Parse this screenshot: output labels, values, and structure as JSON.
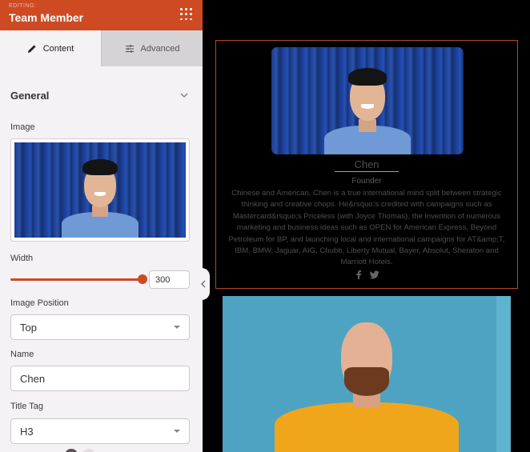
{
  "editor": {
    "editing_label": "EDITING:",
    "module_title": "Team Member",
    "menu_icon": "grid-dots-icon",
    "tabs": [
      {
        "label": "Content",
        "icon": "pencil-icon",
        "active": true
      },
      {
        "label": "Advanced",
        "icon": "sliders-icon",
        "active": false
      }
    ],
    "section": {
      "label": "General",
      "icon": "chevron-down-icon"
    },
    "fields": {
      "image": {
        "label": "Image",
        "alt": "Smiling man in light blue shirt against a blue corrugated wall"
      },
      "width": {
        "label": "Width",
        "value": "300",
        "slider_fraction": 1.0
      },
      "image_position": {
        "label": "Image Position",
        "value": "Top"
      },
      "name": {
        "label": "Name",
        "value": "Chen"
      },
      "title_tag": {
        "label": "Title Tag",
        "value": "H3"
      }
    },
    "collapse_icon": "chevron-left-icon"
  },
  "preview": {
    "card": {
      "name": "Chen",
      "role": "Founder",
      "bio": "Chinese and American, Chen is a true international mind split between strategic thinking and creative chops. He&rsquo;s credited with campaigns such as Mastercard&rsquo;s Priceless (with Joyce Thomas), the invention of numerous marketing and business ideas such as OPEN for American Express, Beyond Petroleum for BP, and launching local and international campaigns for AT&amp;T, IBM, BMW, Jaguar, AIG, Chubb, Liberty Mutual, Bayer, Absolut, Sheraton and Marriott Hotels.",
      "social": [
        {
          "name": "facebook",
          "icon": "facebook-icon"
        },
        {
          "name": "twitter",
          "icon": "twitter-icon"
        }
      ]
    },
    "second_member_image_alt": "Bald bearded man with glasses in yellow sweater against a light blue background"
  },
  "colors": {
    "accent": "#cd4a22",
    "sidebar_bg": "#f4f2f4",
    "inactive_tab": "#d6d3d7",
    "card_border": "#b14a25"
  }
}
